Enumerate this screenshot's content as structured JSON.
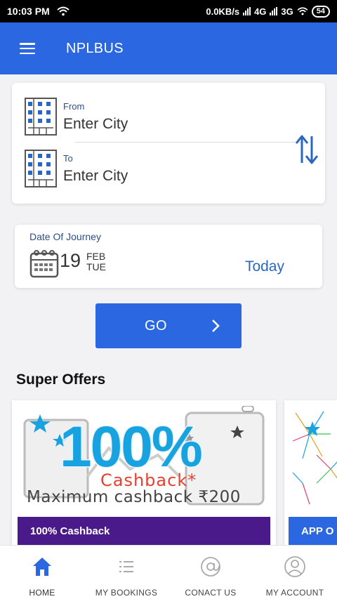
{
  "status_bar": {
    "time": "10:03 PM",
    "network_speed": "0.0KB/s",
    "net_a": "4G",
    "net_b": "3G",
    "battery": "54"
  },
  "app_bar": {
    "title": "NPLBUS"
  },
  "journey": {
    "from_label": "From",
    "from_value": "Enter City",
    "to_label": "To",
    "to_value": "Enter City"
  },
  "date": {
    "label": "Date Of Journey",
    "day": "19",
    "month": "FEB",
    "weekday": "TUE",
    "today_label": "Today"
  },
  "go_button": {
    "label": "GO"
  },
  "offers": {
    "title": "Super Offers",
    "items": [
      {
        "percent_text": "100%",
        "cashback_text": "Cashback*",
        "max_text": "Maximum cashback ₹200",
        "footer_label": "100% Cashback"
      },
      {
        "footer_label": "APP O"
      }
    ]
  },
  "bottom_nav": {
    "items": [
      {
        "label": "HOME",
        "icon": "home-icon",
        "active": true
      },
      {
        "label": "MY BOOKINGS",
        "icon": "list-icon",
        "active": false
      },
      {
        "label": "CONACT US",
        "icon": "at-icon",
        "active": false
      },
      {
        "label": "MY ACCOUNT",
        "icon": "user-icon",
        "active": false
      }
    ]
  },
  "colors": {
    "primary": "#2a67e0",
    "offer_footer": "#4a1a8a",
    "cashback_red": "#e84030",
    "percent_blue": "#18a3e0"
  }
}
